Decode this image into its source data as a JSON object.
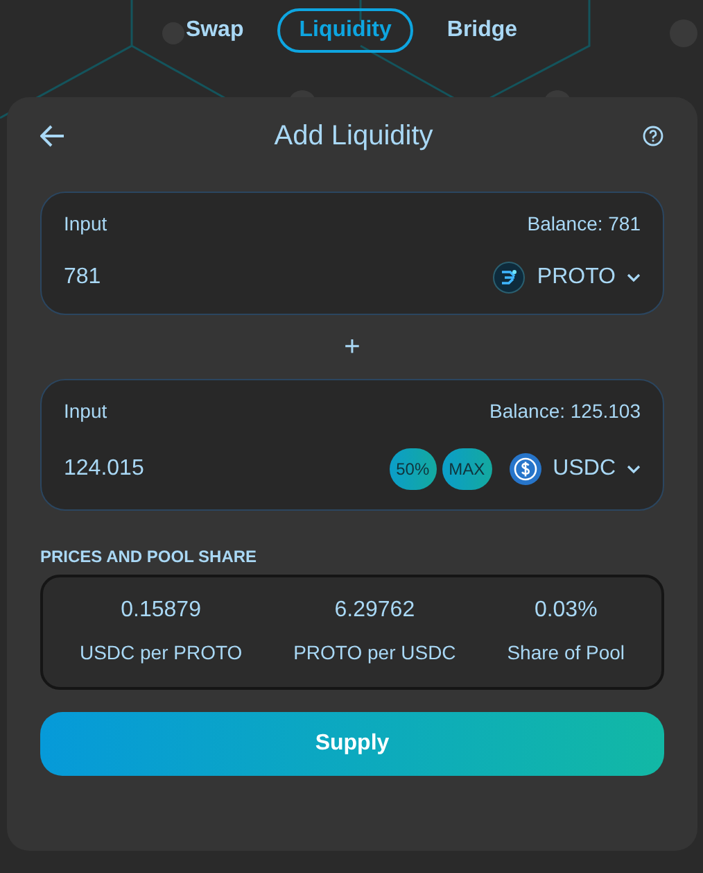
{
  "nav_tabs": [
    {
      "label": "Swap",
      "selected": false
    },
    {
      "label": "Liquidity",
      "selected": true
    },
    {
      "label": "Bridge",
      "selected": false
    }
  ],
  "panel": {
    "title": "Add Liquidity"
  },
  "inputs": [
    {
      "label": "Input",
      "balance": "Balance: 781",
      "amount": "781",
      "token": "PROTO",
      "kind": "proto"
    },
    {
      "label": "Input",
      "balance": "Balance: 125.103",
      "amount": "124.015",
      "token": "USDC",
      "kind": "usdc",
      "quick_buttons": [
        "50%",
        "MAX"
      ]
    }
  ],
  "separator": "+",
  "prices": {
    "heading": "PRICES AND POOL SHARE",
    "stats": [
      {
        "value": "0.15879",
        "label": "USDC per PROTO"
      },
      {
        "value": "6.29762",
        "label": "PROTO per USDC"
      },
      {
        "value": "0.03%",
        "label": "Share of Pool"
      }
    ]
  },
  "supply_button": "Supply"
}
